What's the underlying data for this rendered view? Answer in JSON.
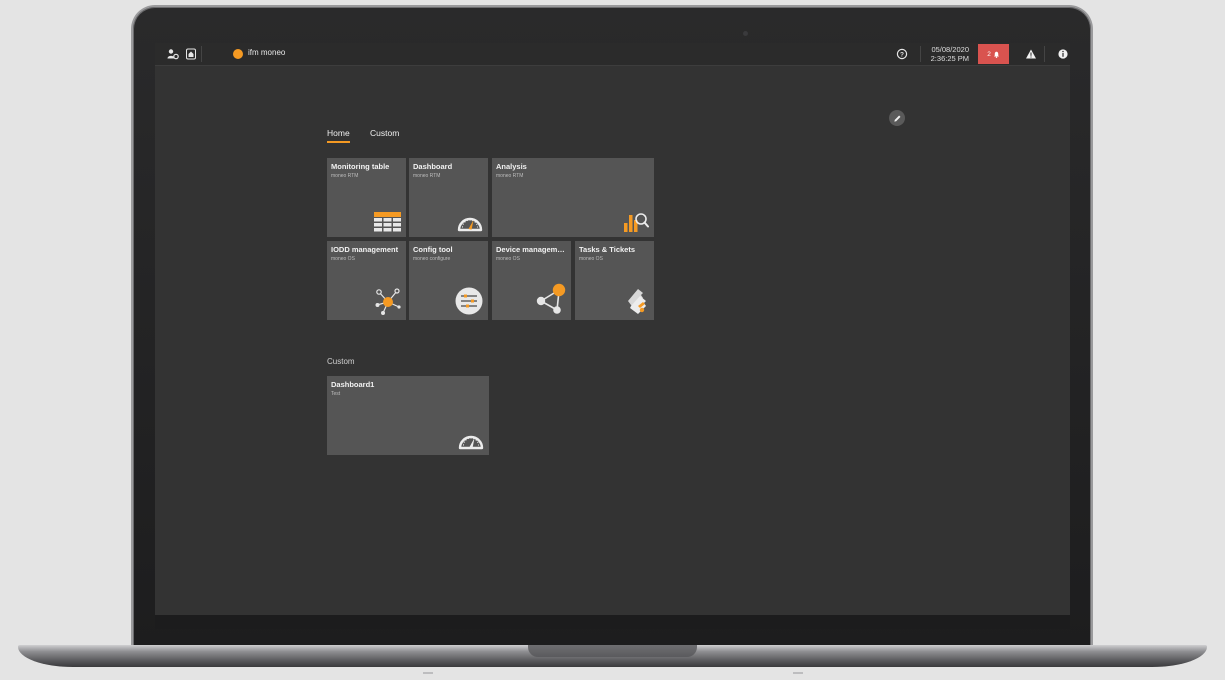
{
  "topbar": {
    "app_title": "ifm moneo",
    "date": "05/08/2020",
    "time": "2:36:25 PM",
    "notification_count": "2"
  },
  "tabs": [
    {
      "label": "Home",
      "active": true
    },
    {
      "label": "Custom",
      "active": false
    }
  ],
  "home_tiles": [
    {
      "title": "Monitoring table",
      "subtitle": "moneo RTM",
      "icon": "monitoring-table-icon"
    },
    {
      "title": "Dashboard",
      "subtitle": "moneo RTM",
      "icon": "gauge-icon"
    },
    {
      "title": "Analysis",
      "subtitle": "moneo RTM",
      "icon": "analysis-chart-icon"
    },
    {
      "title": "IODD management",
      "subtitle": "moneo OS",
      "icon": "iodd-network-icon"
    },
    {
      "title": "Config tool",
      "subtitle": "moneo configure",
      "icon": "config-sliders-icon"
    },
    {
      "title": "Device manageme...",
      "subtitle": "moneo OS",
      "icon": "device-share-icon"
    },
    {
      "title": "Tasks & Tickets",
      "subtitle": "moneo OS",
      "icon": "tickets-icon"
    }
  ],
  "custom_section": {
    "title": "Custom",
    "tiles": [
      {
        "title": "Dashboard1",
        "subtitle": "Test",
        "icon": "gauge-icon"
      }
    ]
  },
  "colors": {
    "accent": "#f59a23",
    "screen_bg": "#333333",
    "tile_bg": "#555555",
    "notification_bg": "#d9534f"
  }
}
